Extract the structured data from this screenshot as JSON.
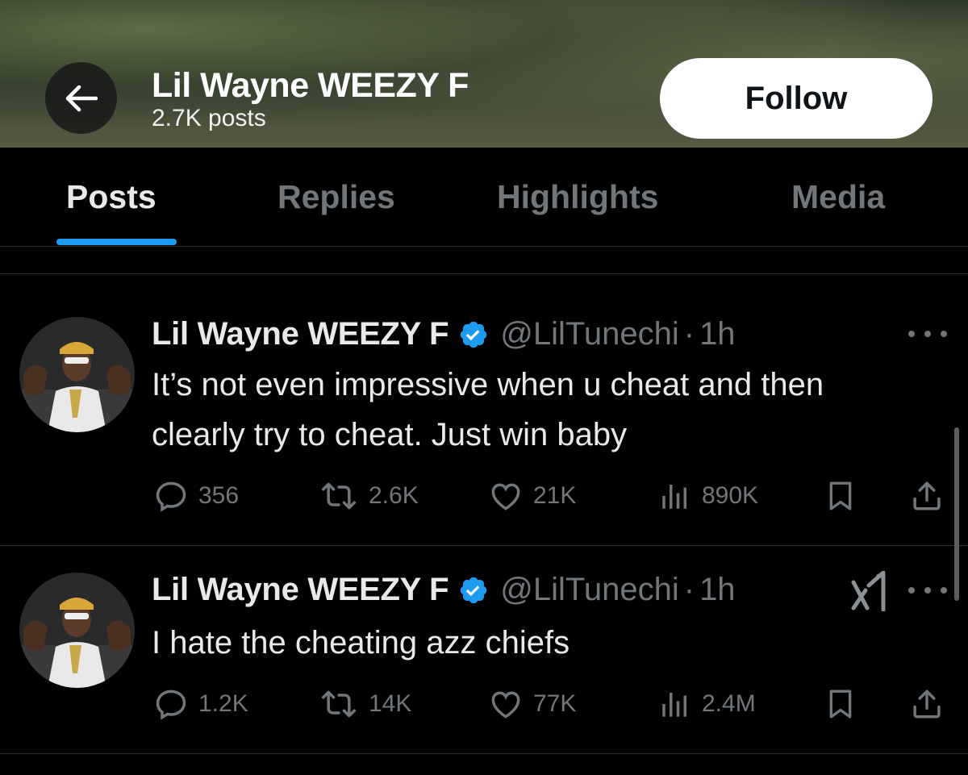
{
  "header": {
    "title": "Lil Wayne WEEZY F",
    "posts_count": "2.7K posts",
    "follow_label": "Follow"
  },
  "tabs": [
    {
      "label": "Posts",
      "active": true
    },
    {
      "label": "Replies",
      "active": false
    },
    {
      "label": "Highlights",
      "active": false
    },
    {
      "label": "Media",
      "active": false
    }
  ],
  "colors": {
    "accent": "#1d9bf0",
    "muted": "#71767b",
    "text": "#e7e9ea",
    "background": "#000000"
  },
  "posts": [
    {
      "name": "Lil Wayne WEEZY F",
      "handle": "@LilTunechi",
      "separator": "·",
      "time": "1h",
      "text": "It’s not even impressive when u cheat and then clearly try to cheat. Just win baby",
      "replies": "356",
      "reposts": "2.6K",
      "likes": "21K",
      "views": "890K",
      "icons": [
        "reply-icon",
        "repost-icon",
        "like-icon",
        "views-icon",
        "bookmark-icon",
        "share-icon",
        "more-icon"
      ]
    },
    {
      "name": "Lil Wayne WEEZY F",
      "handle": "@LilTunechi",
      "separator": "·",
      "time": "1h",
      "text": "I hate the cheating azz chiefs",
      "replies": "1.2K",
      "reposts": "14K",
      "likes": "77K",
      "views": "2.4M",
      "icons": [
        "grok-icon",
        "reply-icon",
        "repost-icon",
        "like-icon",
        "views-icon",
        "bookmark-icon",
        "share-icon",
        "more-icon"
      ]
    }
  ]
}
